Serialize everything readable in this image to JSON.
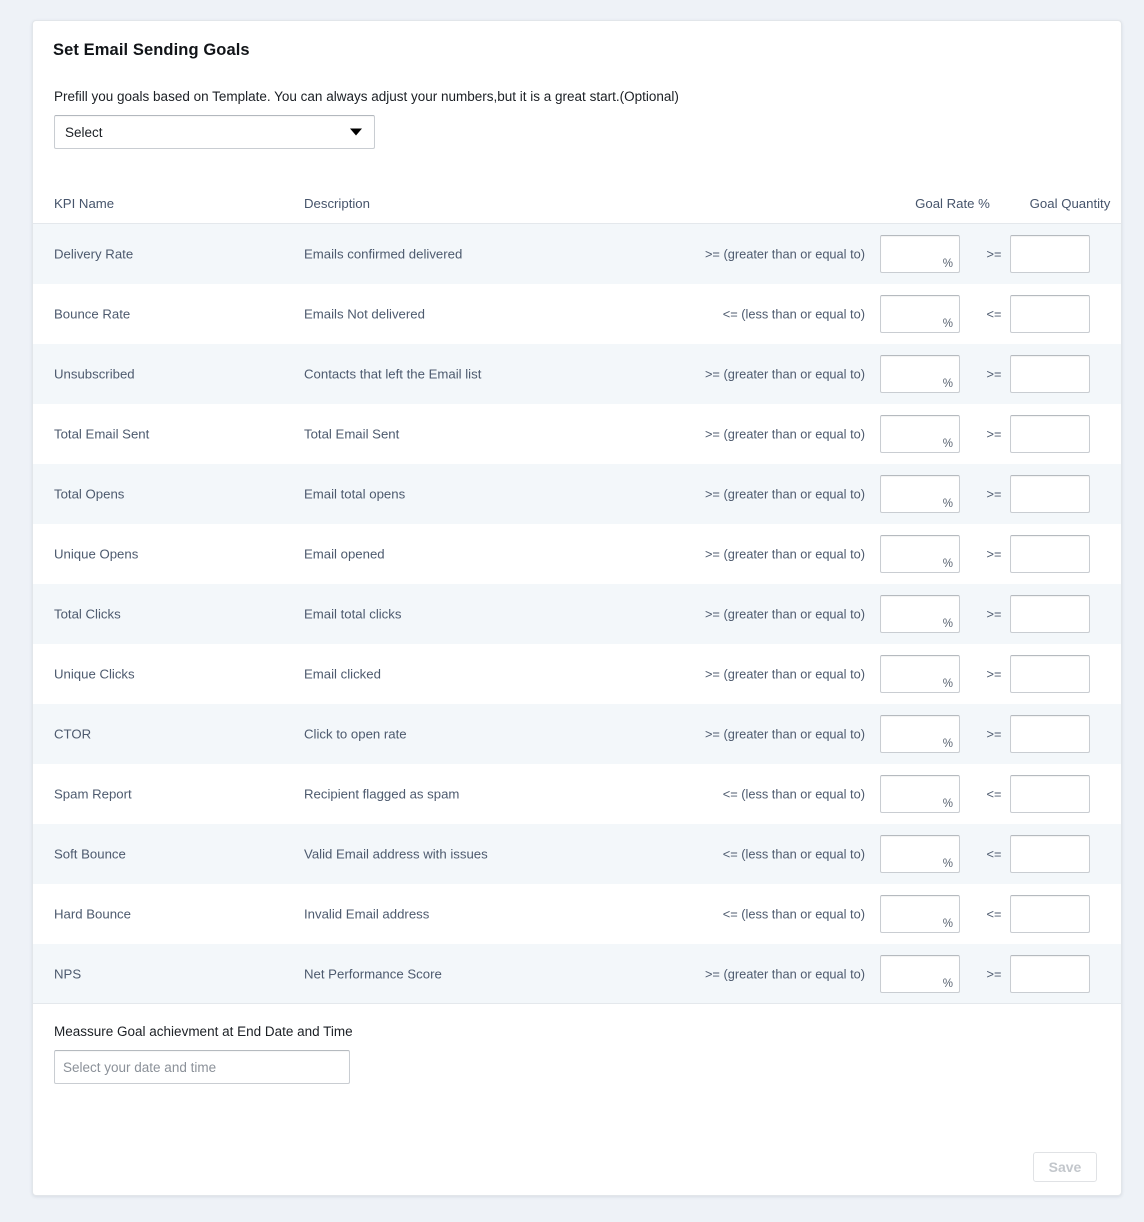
{
  "card": {
    "title": "Set Email Sending Goals",
    "prefill_note": "Prefill you goals based on Template. You can always adjust your numbers,but it is a great start.(Optional)",
    "template_select": {
      "value": "Select",
      "caret_icon": "chevron-down-icon"
    }
  },
  "table": {
    "headers": {
      "kpi_name": "KPI Name",
      "description": "Description",
      "goal_rate": "Goal Rate %",
      "goal_quantity": "Goal Quantity"
    },
    "percent_suffix": "%",
    "rate_placeholder": "",
    "quantity_placeholder": "",
    "rows": [
      {
        "kpi": "Delivery Rate",
        "description": "Emails confirmed delivered",
        "operator_long": ">= (greater than or equal to)",
        "operator_short": ">=",
        "rate_value": "",
        "quantity_value": ""
      },
      {
        "kpi": "Bounce Rate",
        "description": "Emails Not delivered",
        "operator_long": "<= (less than or equal to)",
        "operator_short": "<=",
        "rate_value": "",
        "quantity_value": ""
      },
      {
        "kpi": "Unsubscribed",
        "description": "Contacts that left the Email list",
        "operator_long": ">= (greater than or equal to)",
        "operator_short": ">=",
        "rate_value": "",
        "quantity_value": ""
      },
      {
        "kpi": "Total Email Sent",
        "description": "Total Email Sent",
        "operator_long": ">= (greater than or equal to)",
        "operator_short": ">=",
        "rate_value": "",
        "quantity_value": ""
      },
      {
        "kpi": "Total Opens",
        "description": "Email total opens",
        "operator_long": ">= (greater than or equal to)",
        "operator_short": ">=",
        "rate_value": "",
        "quantity_value": ""
      },
      {
        "kpi": "Unique Opens",
        "description": "Email opened",
        "operator_long": ">= (greater than or equal to)",
        "operator_short": ">=",
        "rate_value": "",
        "quantity_value": ""
      },
      {
        "kpi": "Total Clicks",
        "description": "Email total clicks",
        "operator_long": ">= (greater than or equal to)",
        "operator_short": ">=",
        "rate_value": "",
        "quantity_value": ""
      },
      {
        "kpi": "Unique Clicks",
        "description": "Email clicked",
        "operator_long": ">= (greater than or equal to)",
        "operator_short": ">=",
        "rate_value": "",
        "quantity_value": ""
      },
      {
        "kpi": "CTOR",
        "description": "Click to open rate",
        "operator_long": ">= (greater than or equal to)",
        "operator_short": ">=",
        "rate_value": "",
        "quantity_value": ""
      },
      {
        "kpi": "Spam Report",
        "description": "Recipient flagged as spam",
        "operator_long": "<= (less than or equal to)",
        "operator_short": "<=",
        "rate_value": "",
        "quantity_value": ""
      },
      {
        "kpi": "Soft Bounce",
        "description": "Valid Email address with issues",
        "operator_long": "<= (less than or equal to)",
        "operator_short": "<=",
        "rate_value": "",
        "quantity_value": ""
      },
      {
        "kpi": "Hard Bounce",
        "description": "Invalid Email address",
        "operator_long": "<= (less than or equal to)",
        "operator_short": "<=",
        "rate_value": "",
        "quantity_value": ""
      },
      {
        "kpi": "NPS",
        "description": "Net Performance Score",
        "operator_long": ">= (greater than or equal to)",
        "operator_short": ">=",
        "rate_value": "",
        "quantity_value": ""
      }
    ]
  },
  "footer": {
    "measure_label": "Meassure Goal achievment at End Date and Time",
    "date_placeholder": "Select your date and time",
    "date_value": "",
    "save_label": "Save",
    "save_disabled": true
  },
  "colors": {
    "page_background": "#eef2f7",
    "card_background": "#ffffff",
    "row_stripe": "#f3f7fa",
    "text_primary": "#1b1f24",
    "text_muted": "#4d5a6e",
    "border": "#e4e8ec",
    "save_disabled_text": "#c3c7cc"
  }
}
